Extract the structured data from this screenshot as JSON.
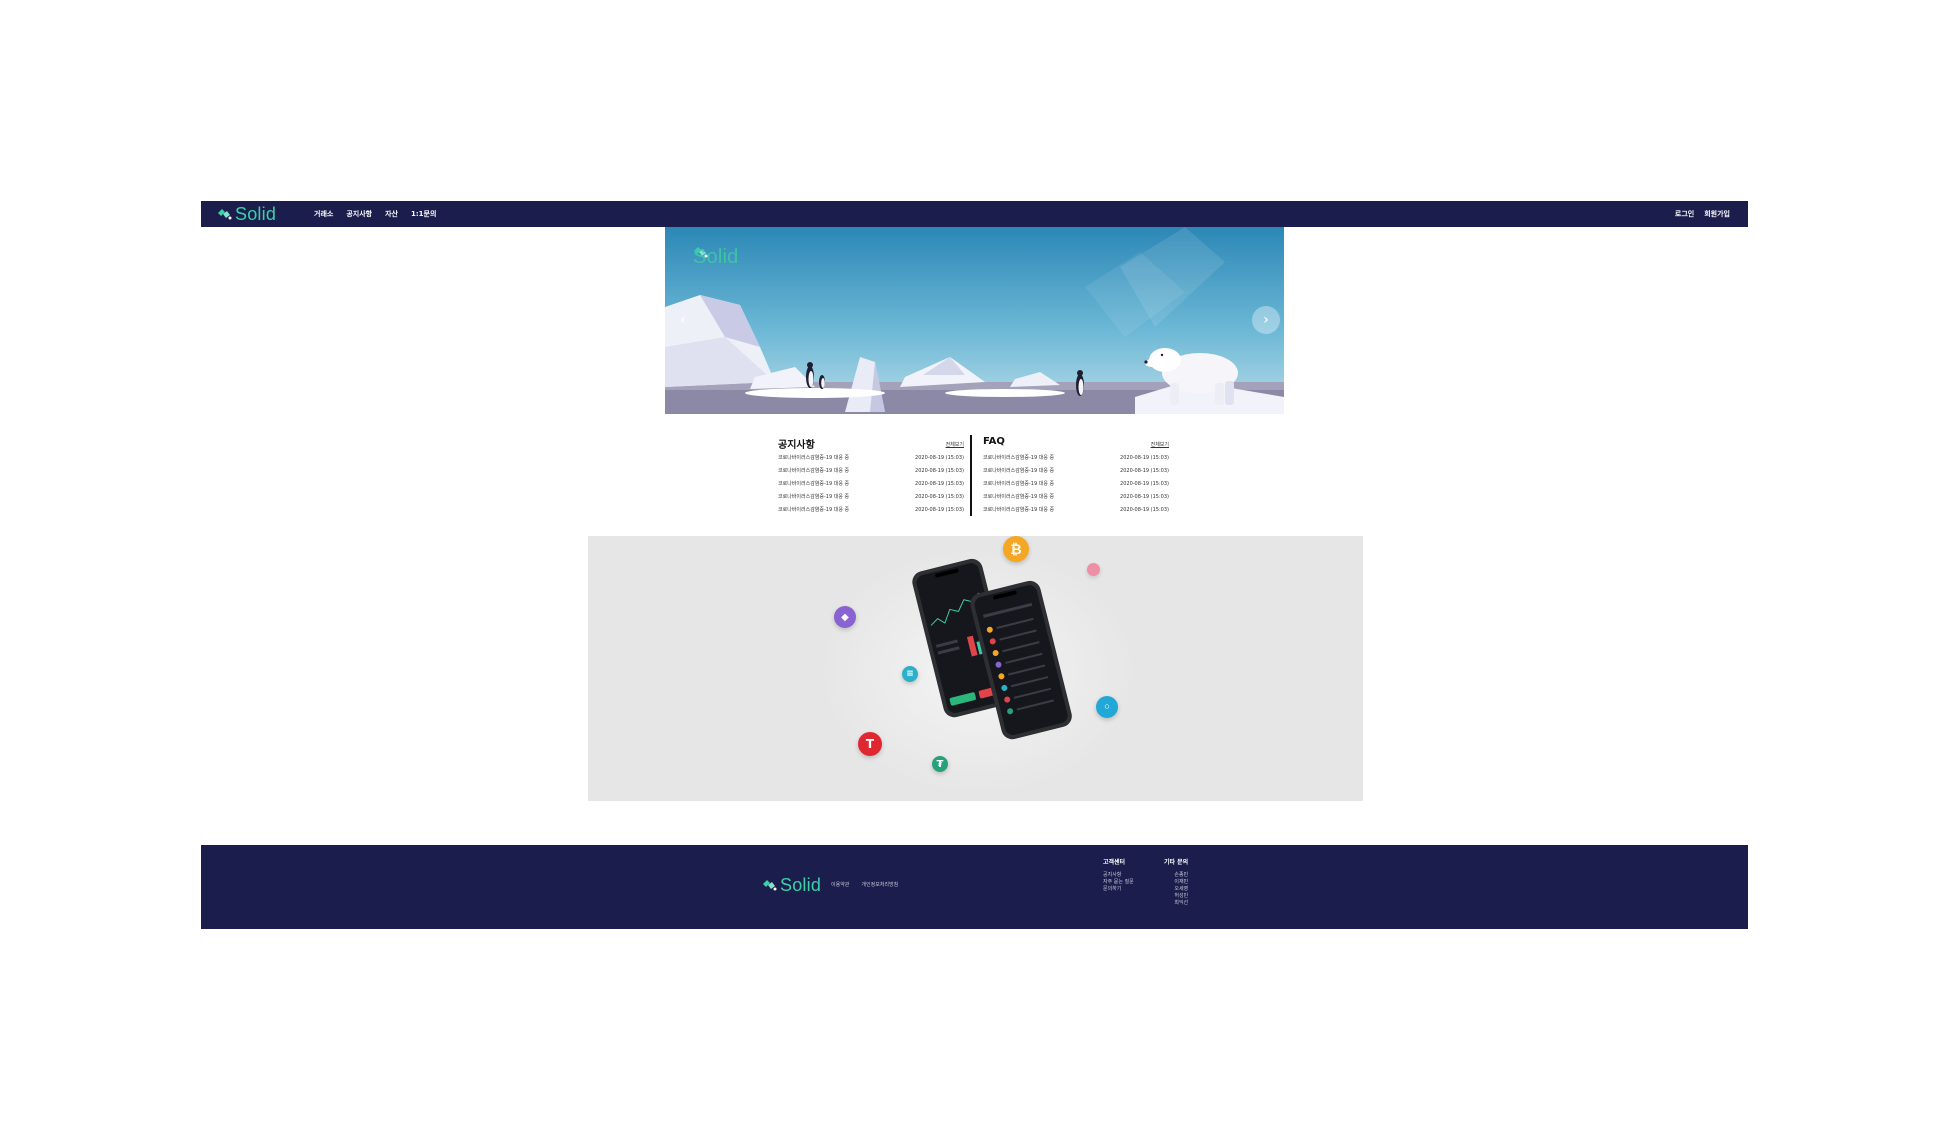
{
  "brand": {
    "name": "Solid",
    "accent": "#38d1a8",
    "navy": "#1b1d4d"
  },
  "header": {
    "nav": [
      "거래소",
      "공지사항",
      "자산",
      "1:1문의"
    ],
    "auth": {
      "login": "로그인",
      "signup": "회원가입"
    }
  },
  "hero": {
    "brand": "Solid",
    "prev_icon": "chevron-left-icon",
    "prev_glyph": "‹",
    "next_icon": "chevron-right-icon",
    "next_glyph": "›"
  },
  "notice": {
    "title": "공지사항",
    "more": "전체보기",
    "items": [
      {
        "text": "코로나바이러스감염증-19 대응 중",
        "date": "2020-08-19 (15:03)"
      },
      {
        "text": "코로나바이러스감염증-19 대응 중",
        "date": "2020-08-19 (15:03)"
      },
      {
        "text": "코로나바이러스감염증-19 대응 중",
        "date": "2020-08-19 (15:03)"
      },
      {
        "text": "코로나바이러스감염증-19 대응 중",
        "date": "2020-08-19 (15:03)"
      },
      {
        "text": "코로나바이러스감염증-19 대응 중",
        "date": "2020-08-19 (15:03)"
      }
    ]
  },
  "faq": {
    "title": "FAQ",
    "more": "전체보기",
    "items": [
      {
        "text": "코로나바이러스감염증-19 대응 중",
        "date": "2020-08-19 (15:03)"
      },
      {
        "text": "코로나바이러스감염증-19 대응 중",
        "date": "2020-08-19 (15:03)"
      },
      {
        "text": "코로나바이러스감염증-19 대응 중",
        "date": "2020-08-19 (15:03)"
      },
      {
        "text": "코로나바이러스감염증-19 대응 중",
        "date": "2020-08-19 (15:03)"
      },
      {
        "text": "코로나바이러스감염증-19 대응 중",
        "date": "2020-08-19 (15:03)"
      }
    ]
  },
  "promo": {
    "coins": [
      {
        "icon": "bitcoin-icon",
        "glyph": "₿",
        "color": "#f5a623"
      },
      {
        "icon": "ethereum-icon",
        "glyph": "◆",
        "color": "#8a63d2"
      },
      {
        "icon": "tesla-icon",
        "glyph": "T",
        "color": "#e02730"
      },
      {
        "icon": "tether-icon",
        "glyph": "₮",
        "color": "#26a17b"
      },
      {
        "icon": "stellar-icon",
        "glyph": "≡",
        "color": "#2ab0c9"
      },
      {
        "icon": "ring-coin-icon",
        "glyph": "◦",
        "color": "#22a8d6"
      },
      {
        "icon": "pink-coin-icon",
        "glyph": "",
        "color": "#f06b8c"
      }
    ]
  },
  "footer": {
    "brand": "Solid",
    "links": [
      "이용약관",
      "개인정보처리방침"
    ],
    "customer_center": {
      "title": "고객센터",
      "items": [
        "공지사항",
        "자주 묻는 질문",
        "문의하기"
      ]
    },
    "others": {
      "title": "기타 문의",
      "items": [
        "손종민",
        "이재민",
        "오세영",
        "허성민",
        "최익선"
      ]
    }
  }
}
